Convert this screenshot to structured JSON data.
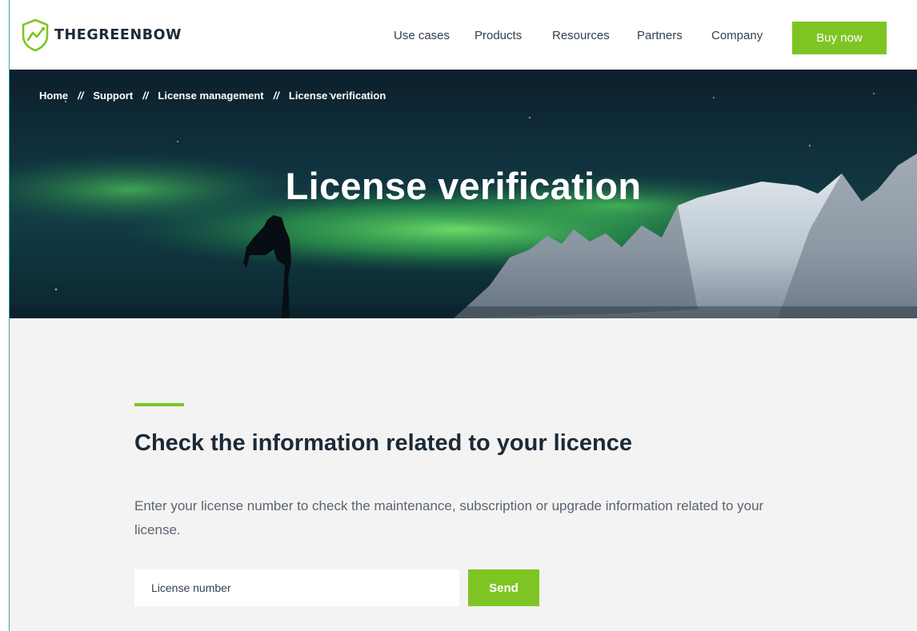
{
  "header": {
    "logo_text": "THEGREENBOW",
    "nav": [
      "Use cases",
      "Products",
      "Resources",
      "Partners",
      "Company"
    ],
    "buy_label": "Buy now"
  },
  "hero": {
    "breadcrumb": [
      "Home",
      "Support",
      "License management",
      "License verification"
    ],
    "breadcrumb_separator": "//",
    "title": "License verification"
  },
  "main": {
    "heading": "Check the information related to your licence",
    "description": "Enter your license number to check the maintenance, subscription or upgrade information related to your license.",
    "license_placeholder": "License number",
    "send_label": "Send"
  },
  "colors": {
    "accent_green": "#7ec524",
    "dark_text": "#1b2a38"
  }
}
